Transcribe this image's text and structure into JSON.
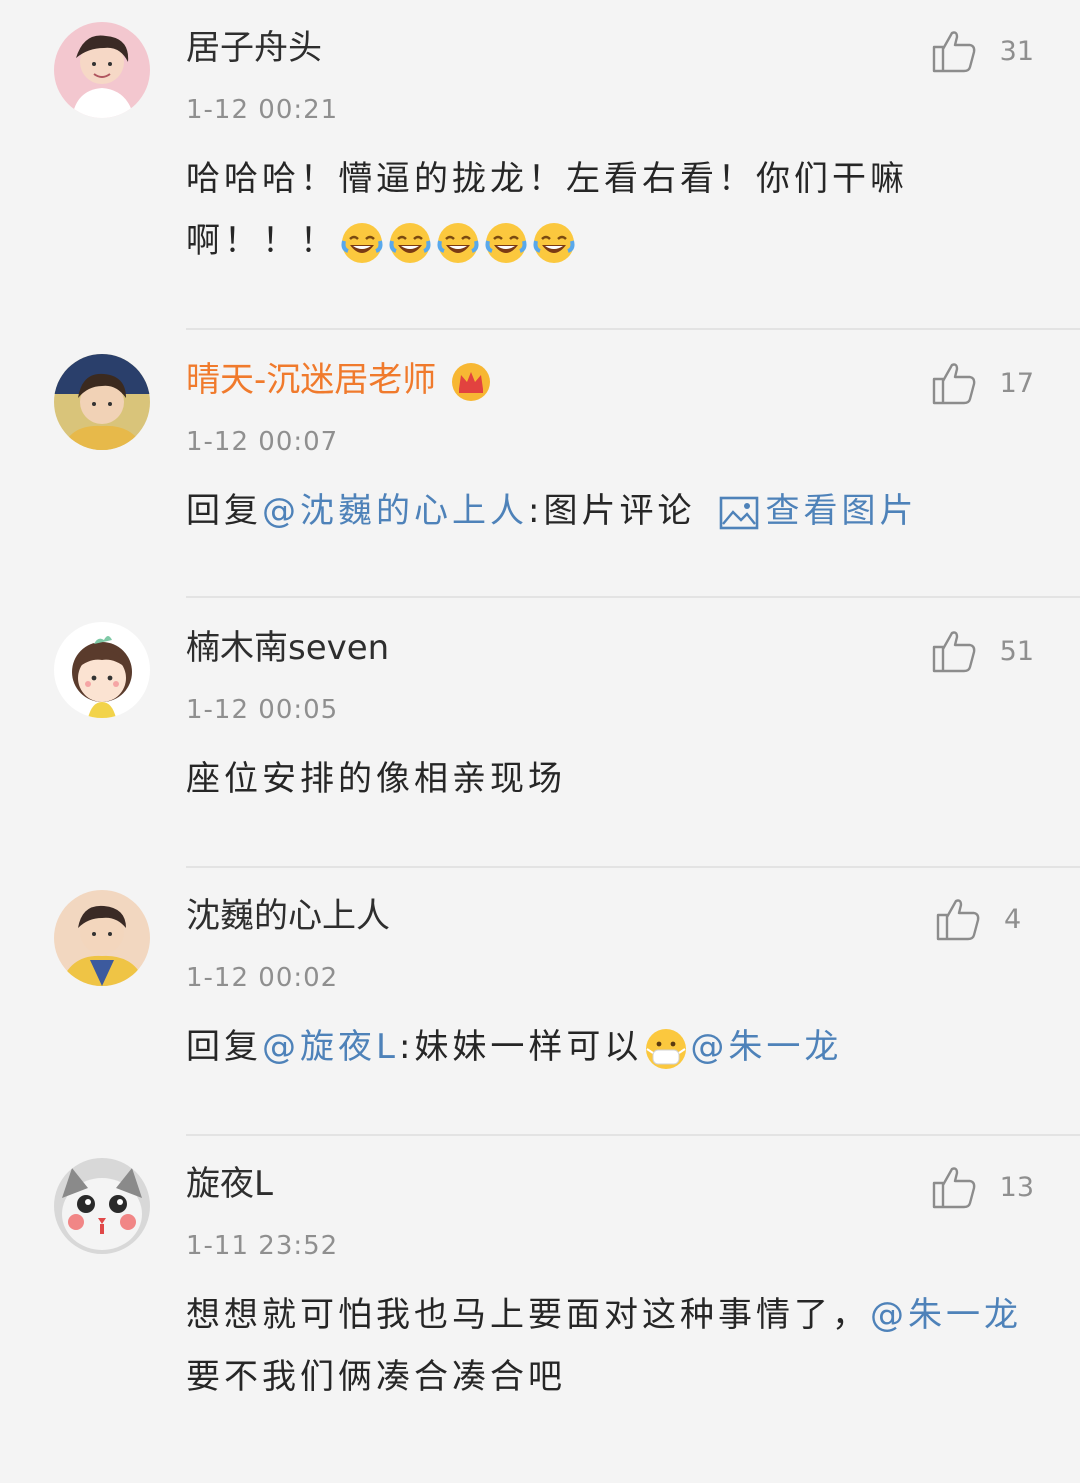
{
  "comments": [
    {
      "username": "居子舟头",
      "time": "1-12  00:21",
      "likes": "31",
      "text": "哈哈哈！懵逼的拢龙！左看右看！你们干嘛啊！！！",
      "emoji_count": 5,
      "emoji": "laugh-cry-emoji"
    },
    {
      "username": "晴天-沉迷居老师",
      "time": "1-12  00:07",
      "likes": "17",
      "reply_prefix": "回复",
      "mention": "@沈巍的心上人",
      "text_after": ":图片评论",
      "view_image": "查看图片",
      "badge": "crown-icon"
    },
    {
      "username": "楠木南seven",
      "time": "1-12  00:05",
      "likes": "51",
      "text": "座位安排的像相亲现场"
    },
    {
      "username": "沈巍的心上人",
      "time": "1-12  00:02",
      "likes": "4",
      "reply_prefix": "回复",
      "mention": "@旋夜L",
      "text_mid": ":妹妹一样可以",
      "mention2": "@朱一龙",
      "emoji": "mask-emoji"
    },
    {
      "username": "旋夜L",
      "time": "1-11  23:52",
      "likes": "13",
      "text": "想想就可怕我也马上要面对这种事情了，",
      "mention": "@朱一龙",
      "text_after": " 要不我们俩凑合凑合吧"
    }
  ],
  "colors": {
    "background": "#f4f4f4",
    "link": "#4e82b9",
    "vip_name": "#f07a2c",
    "meta": "#8f8f8f"
  }
}
